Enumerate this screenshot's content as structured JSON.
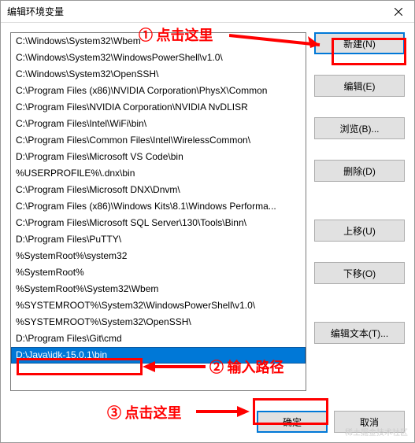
{
  "title": "编辑环境变量",
  "list_items": [
    "C:\\Windows\\System32\\Wbem",
    "C:\\Windows\\System32\\WindowsPowerShell\\v1.0\\",
    "C:\\Windows\\System32\\OpenSSH\\",
    "C:\\Program Files (x86)\\NVIDIA Corporation\\PhysX\\Common",
    "C:\\Program Files\\NVIDIA Corporation\\NVIDIA NvDLISR",
    "C:\\Program Files\\Intel\\WiFi\\bin\\",
    "C:\\Program Files\\Common Files\\Intel\\WirelessCommon\\",
    "D:\\Program Files\\Microsoft VS Code\\bin",
    "%USERPROFILE%\\.dnx\\bin",
    "C:\\Program Files\\Microsoft DNX\\Dnvm\\",
    "C:\\Program Files (x86)\\Windows Kits\\8.1\\Windows Performa...",
    "C:\\Program Files\\Microsoft SQL Server\\130\\Tools\\Binn\\",
    "D:\\Program Files\\PuTTY\\",
    "%SystemRoot%\\system32",
    "%SystemRoot%",
    "%SystemRoot%\\System32\\Wbem",
    "%SYSTEMROOT%\\System32\\WindowsPowerShell\\v1.0\\",
    "%SYSTEMROOT%\\System32\\OpenSSH\\",
    "D:\\Program Files\\Git\\cmd",
    "D:\\Java\\jdk-15.0.1\\bin"
  ],
  "selected_index": 19,
  "buttons": {
    "new": "新建(N)",
    "edit": "编辑(E)",
    "browse": "浏览(B)...",
    "delete": "删除(D)",
    "moveup": "上移(U)",
    "movedown": "下移(O)",
    "edittext": "编辑文本(T)...",
    "ok": "确定",
    "cancel": "取消"
  },
  "annotations": {
    "step1": "① 点击这里",
    "step2": "② 输入路径",
    "step3": "③ 点击这里"
  },
  "watermark": "稀土掘金技术社区",
  "colors": {
    "red": "#ff0000",
    "blue_hl": "#0078d7"
  }
}
